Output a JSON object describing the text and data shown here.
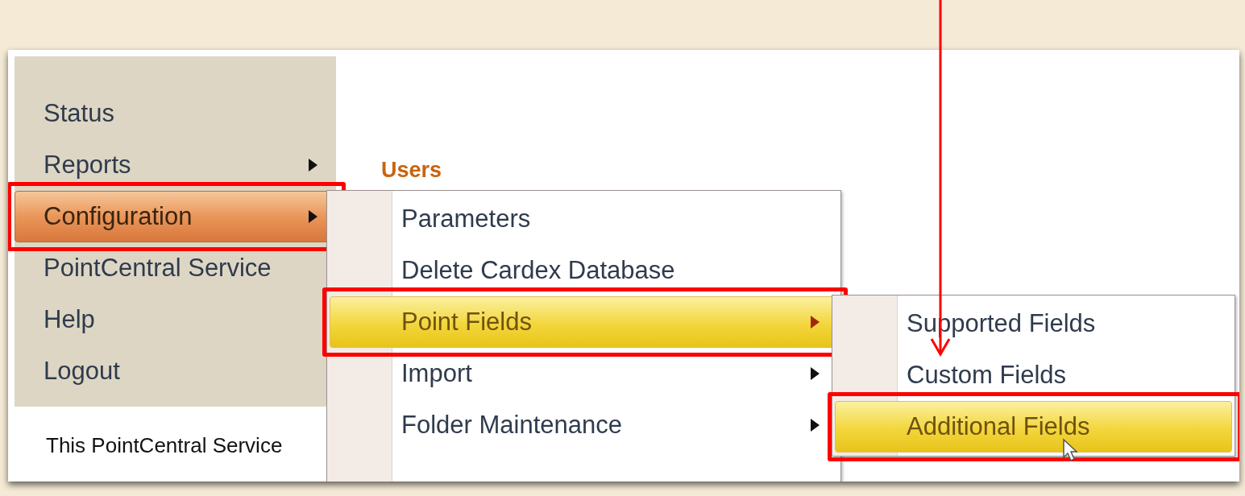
{
  "main_menu": {
    "items": [
      {
        "label": "Status",
        "selected": false,
        "has_submenu": false,
        "highlighted": false
      },
      {
        "label": "Reports",
        "selected": false,
        "has_submenu": true,
        "highlighted": false
      },
      {
        "label": "Configuration",
        "selected": true,
        "has_submenu": true,
        "highlighted": true
      },
      {
        "label": "PointCentral Service",
        "selected": false,
        "has_submenu": false,
        "highlighted": false
      },
      {
        "label": "Help",
        "selected": false,
        "has_submenu": false,
        "highlighted": false
      },
      {
        "label": "Logout",
        "selected": false,
        "has_submenu": false,
        "highlighted": false
      }
    ]
  },
  "section_heading": "Users",
  "configuration_menu": {
    "items": [
      {
        "label": "Parameters",
        "selected": false,
        "has_submenu": false,
        "highlighted": false
      },
      {
        "label": "Delete Cardex Database",
        "selected": false,
        "has_submenu": false,
        "highlighted": false
      },
      {
        "label": "Point Fields",
        "selected": true,
        "has_submenu": true,
        "highlighted": true
      },
      {
        "label": "Import",
        "selected": false,
        "has_submenu": true,
        "highlighted": false
      },
      {
        "label": "Folder Maintenance",
        "selected": false,
        "has_submenu": true,
        "highlighted": false
      }
    ]
  },
  "point_fields_menu": {
    "items": [
      {
        "label": "Supported Fields",
        "selected": false,
        "has_submenu": false,
        "highlighted": false
      },
      {
        "label": "Custom Fields",
        "selected": false,
        "has_submenu": false,
        "highlighted": false
      },
      {
        "label": "Additional Fields",
        "selected": true,
        "has_submenu": false,
        "highlighted": true
      }
    ]
  },
  "body_text": "This PointCentral Service"
}
